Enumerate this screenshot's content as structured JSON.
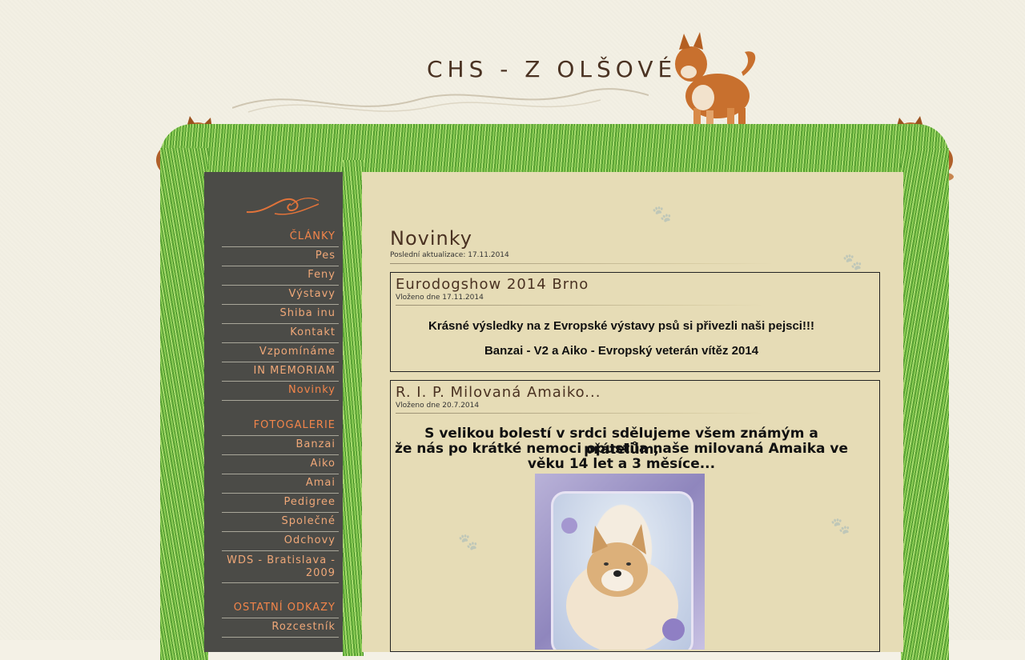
{
  "site": {
    "title": "CHS - Z OLŠOVÉ"
  },
  "sidebar": {
    "items": [
      {
        "label": "ČLÁNKY",
        "type": "head"
      },
      {
        "label": "Pes",
        "type": "link"
      },
      {
        "label": "Feny",
        "type": "link"
      },
      {
        "label": "Výstavy",
        "type": "link"
      },
      {
        "label": "Shiba inu",
        "type": "link"
      },
      {
        "label": "Kontakt",
        "type": "link"
      },
      {
        "label": "Vzpomínáme",
        "type": "link"
      },
      {
        "label": "IN MEMORIAM",
        "type": "link"
      },
      {
        "label": "Novinky",
        "type": "link"
      },
      {
        "label": "FOTOGALERIE",
        "type": "head"
      },
      {
        "label": "Banzai",
        "type": "link"
      },
      {
        "label": "Aiko",
        "type": "link"
      },
      {
        "label": "Amai",
        "type": "link"
      },
      {
        "label": "Pedigree",
        "type": "link"
      },
      {
        "label": "Společné",
        "type": "link"
      },
      {
        "label": "Odchovy",
        "type": "link"
      },
      {
        "label": "WDS - Bratislava - 2009",
        "type": "link"
      },
      {
        "label": "OSTATNÍ ODKAZY",
        "type": "head"
      },
      {
        "label": "Rozcestník",
        "type": "link"
      }
    ]
  },
  "main": {
    "page_title": "Novinky",
    "last_updated": "Poslední aktualizace: 17.11.2014",
    "posts": [
      {
        "title": "Eurodogshow 2014 Brno",
        "date": "Vloženo dne 17.11.2014",
        "lines": [
          "Krásné výsledky na z Evropské výstavy psů si přivezli naši pejsci!!!",
          "Banzai - V2  a  Aiko - Evropský veterán vítěz 2014"
        ]
      },
      {
        "title": "R. I. P. Milovaná Amaiko...",
        "date": "Vloženo dne 20.7.2014",
        "lines": [
          "S velikou bolestí v srdci sdělujeme všem známým a přátelům,",
          "že nás po krátké nemoci opustila naše milovaná Amaika ve",
          "věku 14 let a 3 měsíce..."
        ]
      }
    ]
  },
  "colors": {
    "background": "#f3f0e4",
    "sidebar": "#4b4b47",
    "menu_link": "#f0a878",
    "menu_head": "#f3854a",
    "content": "#e6dcb6",
    "title": "#4a3222"
  }
}
